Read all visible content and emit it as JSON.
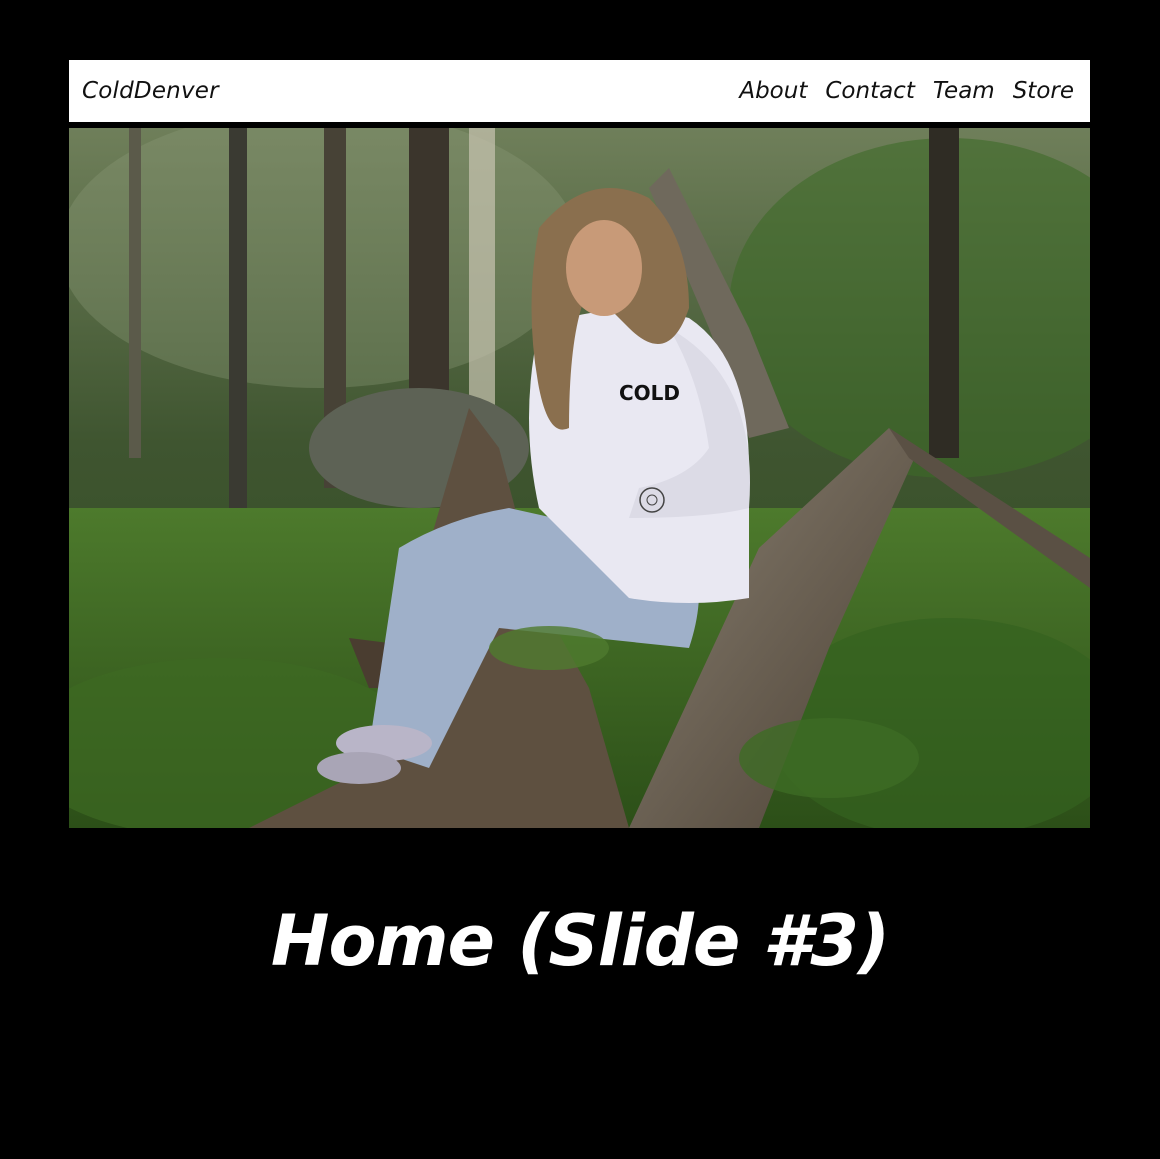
{
  "navbar": {
    "brand": "ColdDenver",
    "links": [
      "About",
      "Contact",
      "Team",
      "Store"
    ]
  },
  "hero": {
    "shirt_print": "COLD"
  },
  "caption": "Home (Slide #3)",
  "colors": {
    "background": "#000000",
    "navbar": "#ffffff",
    "text_dark": "#111111",
    "caption": "#ffffff"
  }
}
